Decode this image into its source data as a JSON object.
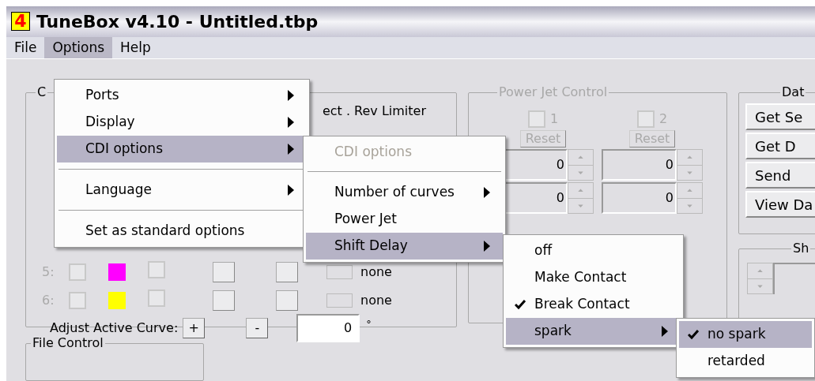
{
  "window": {
    "title": "TuneBox v4.10 - Untitled.tbp",
    "icon_text": "4"
  },
  "menubar": [
    {
      "label": "File",
      "selected": false
    },
    {
      "label": "Options",
      "selected": true
    },
    {
      "label": "Help",
      "selected": false
    }
  ],
  "curve_panel": {
    "title": "C",
    "header_fragment": "ect . Rev Limiter",
    "rows": [
      {
        "label": "5:",
        "color": "#ff00ff",
        "checks": [
          false,
          false
        ],
        "limit": "none"
      },
      {
        "label": "6:",
        "color": "#ffff00",
        "checks": [
          false,
          false
        ],
        "limit": "none"
      }
    ],
    "adjust_label": "Adjust Active Curve:",
    "plus": "+",
    "minus": "-",
    "value": "0",
    "unit": "°"
  },
  "power_jet": {
    "title": "Power Jet Control",
    "disabled": true,
    "channels": [
      {
        "label": "1",
        "checked": false,
        "reset": "Reset",
        "values": [
          "0",
          "0"
        ]
      },
      {
        "label": "2",
        "checked": false,
        "reset": "Reset",
        "values": [
          "0",
          "0"
        ]
      }
    ]
  },
  "data_panel": {
    "title": "Dat",
    "buttons": [
      "Get Se",
      "Get D",
      "Send",
      "View Da"
    ]
  },
  "shift_panel": {
    "title": "Sh"
  },
  "file_panel": {
    "title": "File Control"
  },
  "menus": [
    {
      "items": [
        {
          "kind": "item",
          "label": "Ports",
          "submenu": true,
          "selected": false
        },
        {
          "kind": "item",
          "label": "Display",
          "submenu": true,
          "selected": false
        },
        {
          "kind": "item",
          "label": "CDI options",
          "submenu": true,
          "selected": true
        },
        {
          "kind": "separator"
        },
        {
          "kind": "item",
          "label": "Language",
          "submenu": true,
          "selected": false
        },
        {
          "kind": "separator"
        },
        {
          "kind": "item",
          "label": "Set as standard options",
          "submenu": false,
          "selected": false
        }
      ]
    },
    {
      "items": [
        {
          "kind": "header",
          "label": "CDI options"
        },
        {
          "kind": "separator"
        },
        {
          "kind": "item",
          "label": "Number of curves",
          "submenu": true,
          "selected": false
        },
        {
          "kind": "item",
          "label": "Power Jet",
          "submenu": false,
          "selected": false
        },
        {
          "kind": "item",
          "label": "Shift Delay",
          "submenu": true,
          "selected": true
        }
      ]
    },
    {
      "items": [
        {
          "kind": "item",
          "label": "off",
          "checked": false,
          "selected": false
        },
        {
          "kind": "item",
          "label": "Make Contact",
          "checked": false,
          "selected": false
        },
        {
          "kind": "item",
          "label": "Break Contact",
          "checked": true,
          "selected": false
        },
        {
          "kind": "item",
          "label": "spark",
          "submenu": true,
          "checked": false,
          "selected": true
        }
      ]
    },
    {
      "items": [
        {
          "kind": "item",
          "label": "no spark",
          "checked": true,
          "selected": true
        },
        {
          "kind": "item",
          "label": "retarded",
          "checked": false,
          "selected": false
        }
      ]
    }
  ]
}
